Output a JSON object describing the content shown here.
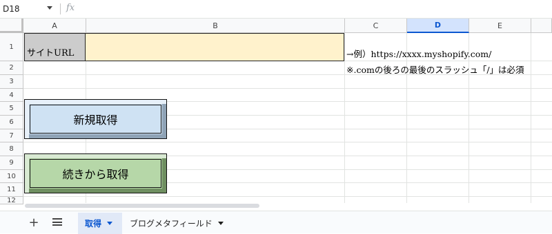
{
  "formula_bar": {
    "cell_ref": "D18",
    "fx_label": "fx"
  },
  "grid": {
    "columns": [
      "A",
      "B",
      "C",
      "D",
      "E"
    ],
    "selected_column": "D",
    "rows": [
      "1",
      "2",
      "3",
      "4",
      "5",
      "6",
      "7",
      "8",
      "9",
      "10",
      "11",
      "12"
    ],
    "cells": {
      "A1": "サイトURL",
      "B1": "",
      "C1": "→例）https://xxxx.myshopify.com/",
      "C2": "※.comの後ろの最後のスラッシュ「/」は必須"
    }
  },
  "buttons": {
    "new_fetch": "新規取得",
    "continue_fetch": "続きから取得"
  },
  "sheet_tabs": {
    "tabs": [
      {
        "label": "取得",
        "active": true
      },
      {
        "label": "ブログメタフィールド",
        "active": false
      }
    ]
  },
  "colors": {
    "a1_bg": "#cccccc",
    "b1_bg": "#fff2cc",
    "new_button_bg": "#cfe2f3",
    "continue_button_bg": "#b6d7a8",
    "accent": "#0b57d0"
  }
}
